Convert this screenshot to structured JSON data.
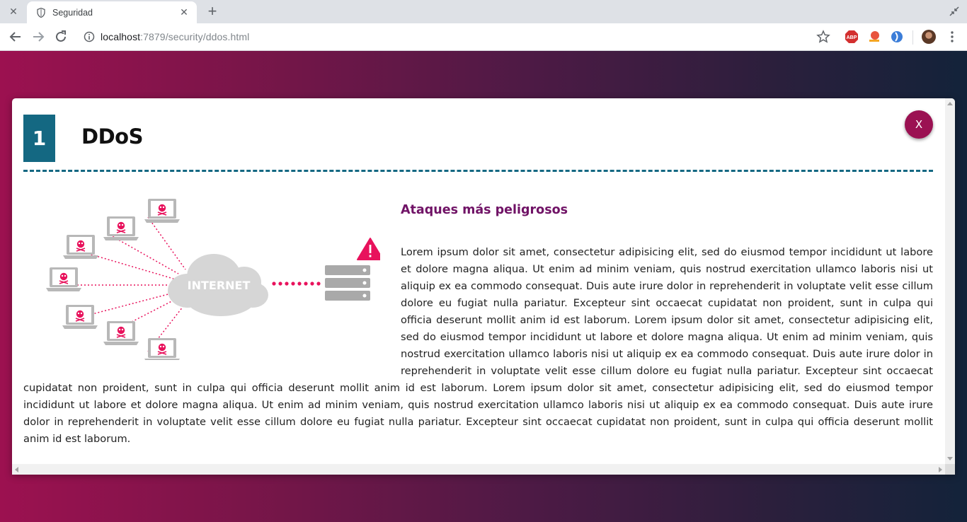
{
  "browser": {
    "tab_title": "Seguridad",
    "url_host": "localhost",
    "url_rest": ":7879/security/ddos.html"
  },
  "modal": {
    "number": "1",
    "title": "DDoS",
    "close_label": "X",
    "illustration_label": "INTERNET",
    "subtitle": "Ataques más peligrosos",
    "body": "Lorem ipsum dolor sit amet, consectetur adipisicing elit, sed do eiusmod tempor incididunt ut labore et dolore magna aliqua. Ut enim ad minim veniam, quis nostrud exercitation ullamco laboris nisi ut aliquip ex ea commodo consequat. Duis aute irure dolor in reprehenderit in voluptate velit esse cillum dolore eu fugiat nulla pariatur. Excepteur sint occaecat cupidatat non proident, sunt in culpa qui officia deserunt mollit anim id est laborum. Lorem ipsum dolor sit amet, consectetur adipisicing elit, sed do eiusmod tempor incididunt ut labore et dolore magna aliqua. Ut enim ad minim veniam, quis nostrud exercitation ullamco laboris nisi ut aliquip ex ea commodo consequat. Duis aute irure dolor in reprehenderit in voluptate velit esse cillum dolore eu fugiat nulla pariatur. Excepteur sint occaecat cupidatat non proident, sunt in culpa qui officia deserunt mollit anim id est laborum. Lorem ipsum dolor sit amet, consectetur adipisicing elit, sed do eiusmod tempor incididunt ut labore et dolore magna aliqua. Ut enim ad minim veniam, quis nostrud exercitation ullamco laboris nisi ut aliquip ex ea commodo consequat. Duis aute irure dolor in reprehenderit in voluptate velit esse cillum dolore eu fugiat nulla pariatur. Excepteur sint occaecat cupidatat non proident, sunt in culpa qui officia deserunt mollit anim id est laborum."
  },
  "colors": {
    "accent_teal": "#146882",
    "accent_magenta": "#9b1152",
    "subtitle_purple": "#701366",
    "alert_pink": "#e8125c"
  }
}
